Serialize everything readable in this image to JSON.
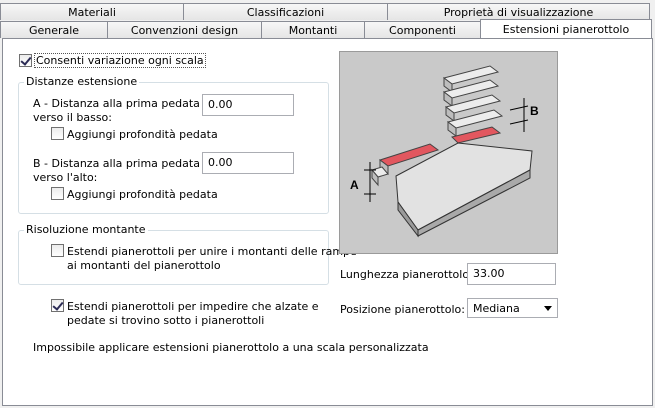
{
  "tabs_back": [
    "Materiali",
    "Classificazioni",
    "Proprietà di visualizzazione"
  ],
  "tabs_front": [
    "Generale",
    "Convenzioni design",
    "Montanti",
    "Componenti",
    "Estensioni pianerottolo"
  ],
  "allow_per_stair": {
    "label": "Consenti variazione ogni scala",
    "checked": true
  },
  "distances": {
    "legend": "Distanze estensione",
    "a_label_line1": "A - Distanza alla prima pedata",
    "a_label_line2": "verso il basso:",
    "a_value": "0.00",
    "a_add_tread": "Aggiungi profondità pedata",
    "b_label_line1": "B - Distanza alla prima pedata",
    "b_label_line2": "verso l'alto:",
    "b_value": "0.00",
    "b_add_tread": "Aggiungi profondità pedata"
  },
  "stringer": {
    "legend": "Risoluzione montante",
    "extend_line1": "Estendi pianerottoli per unire i montanti delle rampe",
    "extend_line2": "ai montanti del pianerottolo"
  },
  "extend_risers": {
    "line1": "Estendi pianerottoli per impedire che alzate e",
    "line2": "pedate si trovino sotto i pianerottoli",
    "checked": true
  },
  "note": "Impossibile applicare estensioni pianerottolo a una scala personalizzata",
  "landing_length": {
    "label": "Lunghezza pianerottolo:",
    "value": "33.00"
  },
  "landing_position": {
    "label": "Posizione pianerottolo:",
    "value": "Mediana"
  },
  "illustration_labels": {
    "a": "A",
    "b": "B"
  },
  "colors": {
    "highlight": "#e2575f",
    "panel_border": "#898c95"
  }
}
